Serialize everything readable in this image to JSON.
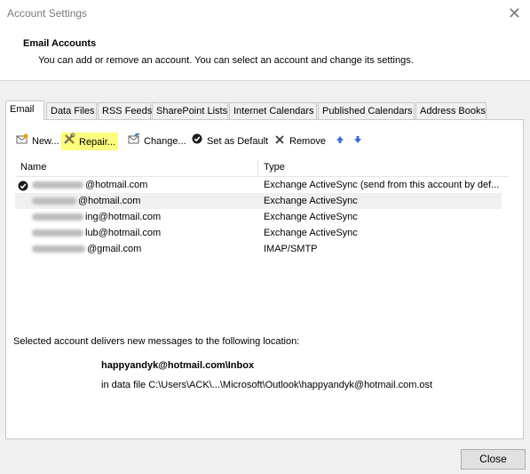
{
  "window": {
    "title": "Account Settings",
    "close_glyph": "✕"
  },
  "header": {
    "title": "Email Accounts",
    "subtitle": "You can add or remove an account. You can select an account and change its settings."
  },
  "tabs": [
    {
      "label": "Email",
      "active": true
    },
    {
      "label": "Data Files"
    },
    {
      "label": "RSS Feeds"
    },
    {
      "label": "SharePoint Lists"
    },
    {
      "label": "Internet Calendars"
    },
    {
      "label": "Published Calendars"
    },
    {
      "label": "Address Books"
    }
  ],
  "toolbar": {
    "new_label": "New...",
    "repair_label": "Repair...",
    "change_label": "Change...",
    "default_label": "Set as Default",
    "remove_label": "Remove",
    "highlight_color": "#fcfc7e",
    "icons": {
      "new": "envelope-icon",
      "repair": "tools-icon",
      "change": "envelope-edit-icon",
      "default": "check-circle-icon",
      "remove": "x-icon",
      "up": "arrow-up-icon",
      "down": "arrow-down-icon"
    }
  },
  "list": {
    "columns": {
      "name": "Name",
      "type": "Type"
    },
    "rows": [
      {
        "default": true,
        "name_visible": "@hotmail.com",
        "type": "Exchange ActiveSync (send from this account by def..."
      },
      {
        "default": false,
        "name_visible": "@hotmail.com",
        "type": "Exchange ActiveSync"
      },
      {
        "default": false,
        "name_visible": "ing@hotmail.com",
        "type": "Exchange ActiveSync"
      },
      {
        "default": false,
        "name_visible": "lub@hotmail.com",
        "type": "Exchange ActiveSync"
      },
      {
        "default": false,
        "name_visible": "@gmail.com",
        "type": "IMAP/SMTP"
      }
    ]
  },
  "location": {
    "label": "Selected account delivers new messages to the following location:",
    "path": "happyandyk@hotmail.com\\Inbox",
    "file": "in data file C:\\Users\\ACK\\...\\Microsoft\\Outlook\\happyandyk@hotmail.com.ost"
  },
  "footer": {
    "close_label": "Close"
  }
}
